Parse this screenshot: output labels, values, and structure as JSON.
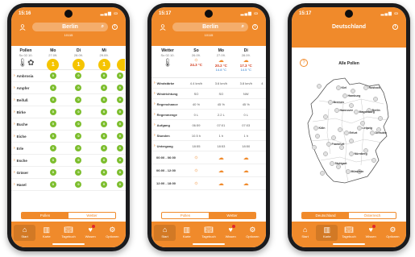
{
  "colors": {
    "accent": "#f08a2b",
    "low": "#7dbe2e",
    "medium": "#f5c400",
    "badge": "#e0282d"
  },
  "phone1": {
    "time": "15:16",
    "city": "Berlin",
    "postal": "10115",
    "first_col": {
      "label": "Pollen",
      "date": "So 02.10."
    },
    "days": [
      {
        "day": "Mo",
        "date": "27.09.",
        "level": "1"
      },
      {
        "day": "Di",
        "date": "28.09.",
        "level": "1"
      },
      {
        "day": "Mi",
        "date": "29.09.",
        "level": "1"
      }
    ],
    "rows": [
      {
        "name": "Ambrosia",
        "values": [
          "0",
          "0",
          "0",
          "0"
        ]
      },
      {
        "name": "Ampfer",
        "values": [
          "0",
          "0",
          "0",
          "0"
        ]
      },
      {
        "name": "Beifuß",
        "values": [
          "0",
          "0",
          "0",
          "0"
        ]
      },
      {
        "name": "Birke",
        "values": [
          "0",
          "0",
          "0",
          "0"
        ]
      },
      {
        "name": "Buche",
        "values": [
          "0",
          "0",
          "0",
          "0"
        ]
      },
      {
        "name": "Eiche",
        "values": [
          "0",
          "0",
          "0",
          "0"
        ]
      },
      {
        "name": "Erle",
        "values": [
          "0",
          "0",
          "0",
          "0"
        ]
      },
      {
        "name": "Esche",
        "values": [
          "0",
          "0",
          "0",
          "0"
        ]
      },
      {
        "name": "Gräser",
        "values": [
          "0",
          "0",
          "0",
          "0"
        ]
      },
      {
        "name": "Hasel",
        "values": [
          "0",
          "0",
          "0",
          "0"
        ]
      }
    ],
    "segment": {
      "left": "Pollen",
      "right": "Wetter",
      "active": "left"
    }
  },
  "phone2": {
    "time": "15:17",
    "city": "Berlin",
    "postal": "10115",
    "first_col": {
      "label": "Wetter",
      "date": "So 02.10."
    },
    "days": [
      {
        "day": "So",
        "date": "26.09.",
        "hi": "24.3 °C",
        "lo": ""
      },
      {
        "day": "Mo",
        "date": "27.09.",
        "hi": "20.2 °C",
        "lo": "14.8 °C"
      },
      {
        "day": "Di",
        "date": "28.09.",
        "hi": "17.3 °C",
        "lo": "14.5 °C"
      }
    ],
    "rows": [
      {
        "name": "Windstärke",
        "values": [
          "4.4 km/h",
          "3.6 km/h",
          "3.8 km/h",
          "4"
        ]
      },
      {
        "name": "Windrichtung",
        "values": [
          "SO",
          "SO",
          "NW",
          ""
        ]
      },
      {
        "name": "Regenchance",
        "values": [
          "40 %",
          "45 %",
          "45 %",
          ""
        ]
      },
      {
        "name": "Regenmenge",
        "values": [
          "0 L",
          "2.2 L",
          "0 L",
          ""
        ]
      },
      {
        "name": "Aufgang",
        "values": [
          "06:59",
          "07:01",
          "07:03",
          ""
        ]
      },
      {
        "name": "Stunden",
        "values": [
          "10.5 h",
          "1 h",
          "1 h",
          ""
        ]
      },
      {
        "name": "Untergang",
        "values": [
          "18:55",
          "18:53",
          "18:50",
          ""
        ]
      }
    ],
    "time_rows": [
      {
        "name": "00:00 - 06:00"
      },
      {
        "name": "06:00 - 12:00"
      },
      {
        "name": "12:00 - 18:00"
      }
    ],
    "segment": {
      "left": "Pollen",
      "right": "Wetter",
      "active": "right"
    }
  },
  "phone3": {
    "time": "15:17",
    "title": "Deutschland",
    "map_title": "Alle Pollen",
    "cities": [
      "Kiel",
      "Rostock",
      "Hamburg",
      "Bremen",
      "Berlin",
      "Hannover",
      "Magdeburg",
      "Dresden",
      "Leipzig",
      "Frankfurt",
      "Stuttgart",
      "München",
      "Nürnberg",
      "Köln",
      "Erfurt"
    ],
    "segment": {
      "left": "Deutschland",
      "right": "Österreich",
      "active": "left"
    }
  },
  "tabs": [
    {
      "label": "Start",
      "icon": "home-icon"
    },
    {
      "label": "Karte",
      "icon": "map-icon"
    },
    {
      "label": "Tagebuch",
      "icon": "book-icon"
    },
    {
      "label": "Wissen",
      "icon": "lightbulb-icon"
    },
    {
      "label": "Optionen",
      "icon": "gear-icon"
    }
  ]
}
